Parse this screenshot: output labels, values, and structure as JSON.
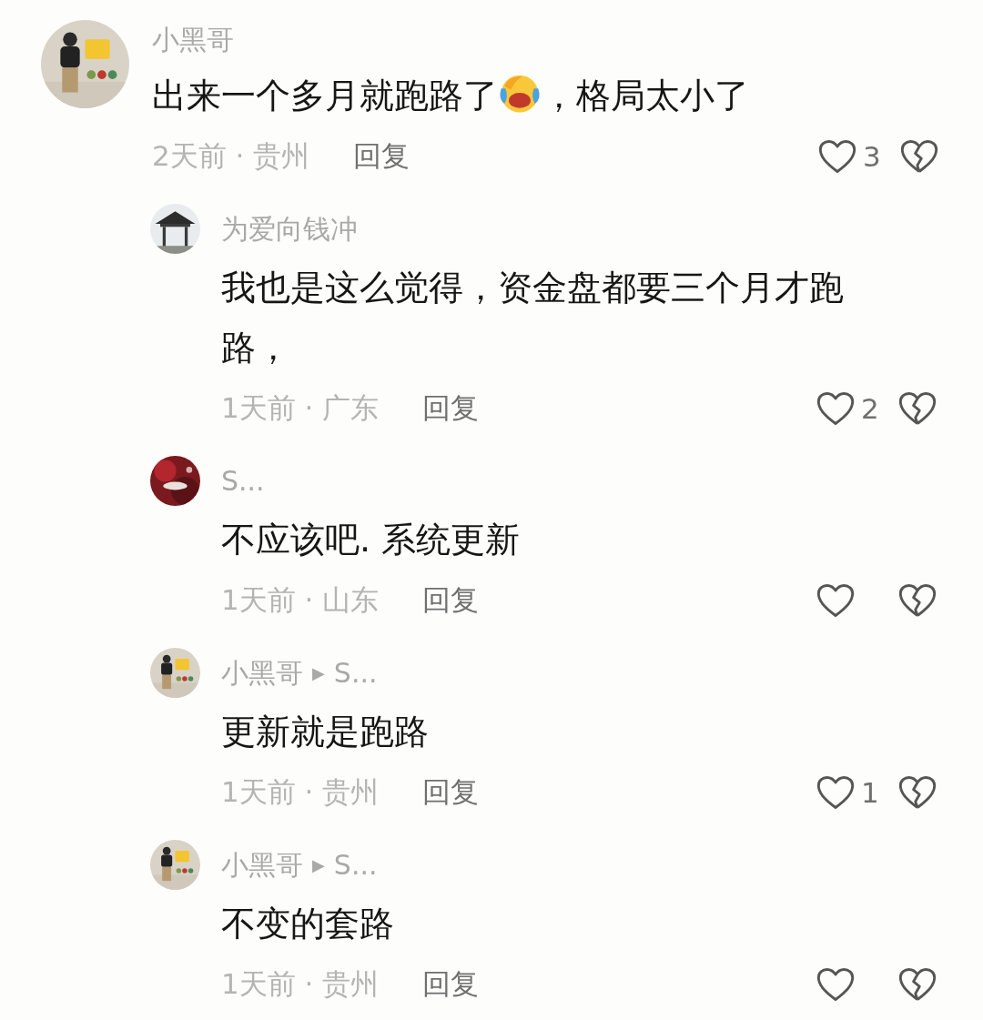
{
  "comments": [
    {
      "author": "小黑哥",
      "avatar": {
        "kind": "picture"
      },
      "body": [
        {
          "kind": "text",
          "text": "出来一个多月就跑路了"
        },
        {
          "kind": "emoji"
        },
        {
          "kind": "text",
          "text": "，格局太小了"
        }
      ],
      "meta": "2天前 · 贵州",
      "reply": "回复",
      "likes": "3",
      "replies": [
        {
          "author": "为爱向钱冲",
          "avatar": {
            "kind": "picture"
          },
          "body": [
            {
              "kind": "text",
              "text": "我也是这么觉得，资金盘都要三个月才跑路，"
            }
          ],
          "meta": "1天前 · 广东",
          "reply": "回复",
          "likes": "2"
        },
        {
          "author": "S...",
          "avatar": {
            "kind": "picture"
          },
          "body": [
            {
              "kind": "text",
              "text": "不应该吧. 系统更新"
            }
          ],
          "meta": "1天前 · 山东",
          "reply": "回复"
        },
        {
          "author": "小黑哥",
          "arrow": "▶",
          "reply_to": "S...",
          "avatar": {
            "kind": "picture"
          },
          "body": [
            {
              "kind": "text",
              "text": "更新就是跑路"
            }
          ],
          "meta": "1天前 · 贵州",
          "reply": "回复",
          "likes": "1"
        },
        {
          "author": "小黑哥",
          "arrow": "▶",
          "reply_to": "S...",
          "avatar": {
            "kind": "picture"
          },
          "body": [
            {
              "kind": "text",
              "text": "不变的套路"
            }
          ],
          "meta": "1天前 · 贵州",
          "reply": "回复"
        }
      ]
    }
  ]
}
